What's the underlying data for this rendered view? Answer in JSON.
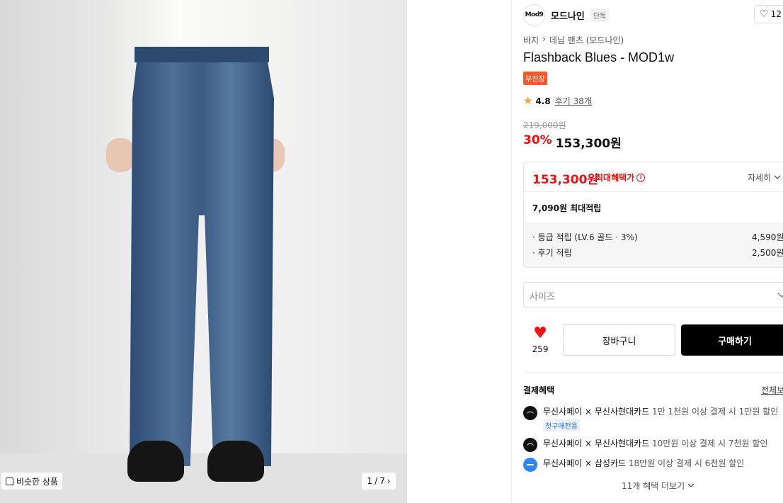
{
  "image": {
    "similar_label": "비슷한 상품",
    "pager_current": "1",
    "pager_sep": "/",
    "pager_total": "7",
    "pager_next": "›"
  },
  "brand": {
    "logo_text": "Mod9",
    "name": "모드나인",
    "tag": "단독",
    "like_count_top": "12"
  },
  "breadcrumb": {
    "parent": "바지",
    "separator": "›",
    "current": "데님 팬츠 (모드나인)"
  },
  "product": {
    "title": "Flashback Blues - MOD1w",
    "badge": "무진장",
    "rating": "4.8",
    "reviews": "후기 38개",
    "original_price": "219,000원",
    "discount": "30%",
    "price": "153,300원"
  },
  "benefit": {
    "max_price": "153,300원",
    "max_label": "최대혜택가",
    "info_symbol": "i",
    "detail": "자세히",
    "points": "7,090원 최대적립",
    "lines": [
      {
        "label": "· 등급 적립 (LV.6 골드 · 3%)",
        "value": "4,590원"
      },
      {
        "label": "· 후기 적립",
        "value": "2,500원"
      }
    ]
  },
  "size": {
    "placeholder": "사이즈"
  },
  "actions": {
    "like_count": "259",
    "cart": "장바구니",
    "buy": "구매하기"
  },
  "payment": {
    "title": "결제혜택",
    "view_all": "전체보기",
    "items": [
      {
        "provider": "무신사페이 × 무신사현대카드",
        "note": "1만 1천원 이상 결제 시 1만원 할인",
        "tag": "첫구매전용"
      },
      {
        "provider": "무신사페이 × 무신사현대카드",
        "note": "10만원 이상 결제 시 7천원 할인"
      },
      {
        "provider": "무신사페이 × 삼성카드",
        "note": "18만원 이상 결제 시 6천원 할인"
      }
    ],
    "more": "11개 혜택 더보기"
  },
  "colors": {
    "accent_red": "#f31110",
    "badge_orange": "#f15a2a",
    "star": "#f5a623"
  }
}
